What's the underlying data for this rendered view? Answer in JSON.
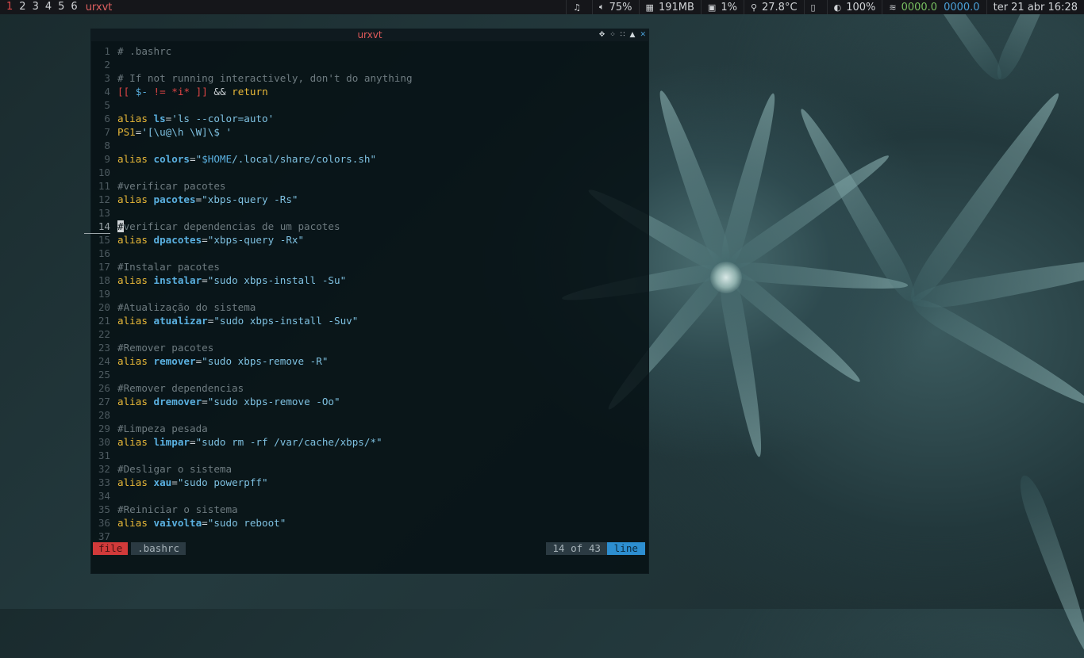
{
  "topbar": {
    "workspaces": [
      "1",
      "2",
      "3",
      "4",
      "5",
      "6"
    ],
    "active_workspace": "1",
    "window_title": "urxvt",
    "status": {
      "music_icon": "music-note-icon",
      "volume": "75%",
      "memory": "191MB",
      "cpu": "1%",
      "temperature": "27.8°C",
      "battery": "100%",
      "net_down": "0000.0",
      "net_up": "0000.0",
      "datetime": "ter 21 abr 16:28"
    }
  },
  "terminal": {
    "title": "urxvt",
    "lines": [
      {
        "n": "1",
        "tokens": [
          [
            "cm",
            "# .bashrc"
          ]
        ]
      },
      {
        "n": "2",
        "tokens": []
      },
      {
        "n": "3",
        "tokens": [
          [
            "cm",
            "# If not running interactively, don't do anything"
          ]
        ]
      },
      {
        "n": "4",
        "tokens": [
          [
            "br",
            "[["
          ],
          [
            "op",
            " "
          ],
          [
            "var",
            "$-"
          ],
          [
            "op",
            " "
          ],
          [
            "br",
            "!="
          ],
          [
            "op",
            " "
          ],
          [
            "br",
            "*i*"
          ],
          [
            "op",
            " "
          ],
          [
            "br",
            "]]"
          ],
          [
            "op",
            " && "
          ],
          [
            "kw",
            "return"
          ]
        ]
      },
      {
        "n": "5",
        "tokens": []
      },
      {
        "n": "6",
        "tokens": [
          [
            "kw",
            "alias "
          ],
          [
            "nm",
            "ls"
          ],
          [
            "op",
            "="
          ],
          [
            "str",
            "'ls --color=auto'"
          ]
        ]
      },
      {
        "n": "7",
        "tokens": [
          [
            "kw",
            "PS1"
          ],
          [
            "op",
            "="
          ],
          [
            "str",
            "'[\\u@\\h \\W]\\$ '"
          ]
        ]
      },
      {
        "n": "8",
        "tokens": []
      },
      {
        "n": "9",
        "tokens": [
          [
            "kw",
            "alias "
          ],
          [
            "nm",
            "colors"
          ],
          [
            "op",
            "="
          ],
          [
            "str",
            "\""
          ],
          [
            "var",
            "$HOME"
          ],
          [
            "str",
            "/.local/share/colors.sh\""
          ]
        ]
      },
      {
        "n": "10",
        "tokens": []
      },
      {
        "n": "11",
        "tokens": [
          [
            "cm",
            "#verificar pacotes"
          ]
        ]
      },
      {
        "n": "12",
        "tokens": [
          [
            "kw",
            "alias "
          ],
          [
            "nm",
            "pacotes"
          ],
          [
            "op",
            "="
          ],
          [
            "str",
            "\"xbps-query -Rs\""
          ]
        ]
      },
      {
        "n": "13",
        "tokens": []
      },
      {
        "n": "14",
        "cur": true,
        "tokens": [
          [
            "cursor",
            "#"
          ],
          [
            "cm",
            "verificar dependencias de um pacotes"
          ]
        ]
      },
      {
        "n": "15",
        "tokens": [
          [
            "kw",
            "alias "
          ],
          [
            "nm",
            "dpacotes"
          ],
          [
            "op",
            "="
          ],
          [
            "str",
            "\"xbps-query -Rx\""
          ]
        ]
      },
      {
        "n": "16",
        "tokens": []
      },
      {
        "n": "17",
        "tokens": [
          [
            "cm",
            "#Instalar pacotes"
          ]
        ]
      },
      {
        "n": "18",
        "tokens": [
          [
            "kw",
            "alias "
          ],
          [
            "nm",
            "instalar"
          ],
          [
            "op",
            "="
          ],
          [
            "str",
            "\"sudo xbps-install -Su\""
          ]
        ]
      },
      {
        "n": "19",
        "tokens": []
      },
      {
        "n": "20",
        "tokens": [
          [
            "cm",
            "#Atualização do sistema"
          ]
        ]
      },
      {
        "n": "21",
        "tokens": [
          [
            "kw",
            "alias "
          ],
          [
            "nm",
            "atualizar"
          ],
          [
            "op",
            "="
          ],
          [
            "str",
            "\"sudo xbps-install -Suv\""
          ]
        ]
      },
      {
        "n": "22",
        "tokens": []
      },
      {
        "n": "23",
        "tokens": [
          [
            "cm",
            "#Remover pacotes"
          ]
        ]
      },
      {
        "n": "24",
        "tokens": [
          [
            "kw",
            "alias "
          ],
          [
            "nm",
            "remover"
          ],
          [
            "op",
            "="
          ],
          [
            "str",
            "\"sudo xbps-remove -R\""
          ]
        ]
      },
      {
        "n": "25",
        "tokens": []
      },
      {
        "n": "26",
        "tokens": [
          [
            "cm",
            "#Remover dependencias"
          ]
        ]
      },
      {
        "n": "27",
        "tokens": [
          [
            "kw",
            "alias "
          ],
          [
            "nm",
            "dremover"
          ],
          [
            "op",
            "="
          ],
          [
            "str",
            "\"sudo xbps-remove -Oo\""
          ]
        ]
      },
      {
        "n": "28",
        "tokens": []
      },
      {
        "n": "29",
        "tokens": [
          [
            "cm",
            "#Limpeza pesada"
          ]
        ]
      },
      {
        "n": "30",
        "tokens": [
          [
            "kw",
            "alias "
          ],
          [
            "nm",
            "limpar"
          ],
          [
            "op",
            "="
          ],
          [
            "str",
            "\"sudo rm -rf /var/cache/xbps/*\""
          ]
        ]
      },
      {
        "n": "31",
        "tokens": []
      },
      {
        "n": "32",
        "tokens": [
          [
            "cm",
            "#Desligar o sistema"
          ]
        ]
      },
      {
        "n": "33",
        "tokens": [
          [
            "kw",
            "alias "
          ],
          [
            "nm",
            "xau"
          ],
          [
            "op",
            "="
          ],
          [
            "str",
            "\"sudo powerpff\""
          ]
        ]
      },
      {
        "n": "34",
        "tokens": []
      },
      {
        "n": "35",
        "tokens": [
          [
            "cm",
            "#Reiniciar o sistema"
          ]
        ]
      },
      {
        "n": "36",
        "tokens": [
          [
            "kw",
            "alias "
          ],
          [
            "nm",
            "vaivolta"
          ],
          [
            "op",
            "="
          ],
          [
            "str",
            "\"sudo reboot\""
          ]
        ]
      },
      {
        "n": "37",
        "tokens": []
      }
    ],
    "statusline": {
      "mode": "file",
      "filename": ".bashrc",
      "position": "14 of 43",
      "type": "line"
    }
  }
}
